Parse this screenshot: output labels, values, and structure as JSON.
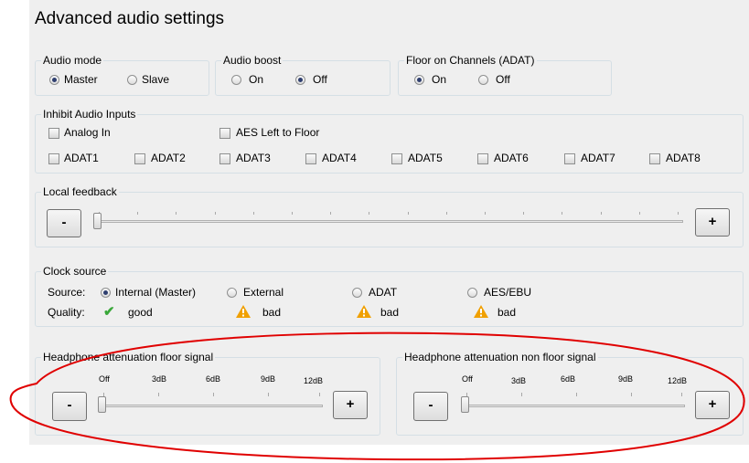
{
  "title": "Advanced audio settings",
  "audio_mode": {
    "label": "Audio mode",
    "options": [
      "Master",
      "Slave"
    ],
    "selected": "Master"
  },
  "audio_boost": {
    "label": "Audio boost",
    "options": [
      "On",
      "Off"
    ],
    "selected": "Off"
  },
  "floor_channels": {
    "label": "Floor on Channels (ADAT)",
    "options": [
      "On",
      "Off"
    ],
    "selected": "On"
  },
  "inhibit": {
    "label": "Inhibit Audio Inputs",
    "analog": "Analog In",
    "aes": "AES Left to Floor",
    "adat": [
      "ADAT1",
      "ADAT2",
      "ADAT3",
      "ADAT4",
      "ADAT5",
      "ADAT6",
      "ADAT7",
      "ADAT8"
    ]
  },
  "local_feedback": {
    "label": "Local feedback",
    "minus": "-",
    "plus": "+",
    "value_fraction": 0
  },
  "clock": {
    "label": "Clock source",
    "source_label": "Source:",
    "quality_label": "Quality:",
    "sources": [
      "Internal (Master)",
      "External",
      "ADAT",
      "AES/EBU"
    ],
    "selected": "Internal (Master)",
    "quality": [
      "good",
      "bad",
      "bad",
      "bad"
    ],
    "quality_icons": [
      "check-icon",
      "warning-icon",
      "warning-icon",
      "warning-icon"
    ]
  },
  "hp_floor": {
    "label": "Headphone attenuation floor signal",
    "scale": [
      "Off",
      "3dB",
      "6dB",
      "9dB",
      "12dB"
    ],
    "minus": "-",
    "plus": "+",
    "value": "Off"
  },
  "hp_nonfloor": {
    "label": "Headphone attenuation non floor signal",
    "scale": [
      "Off",
      "3dB",
      "6dB",
      "9dB",
      "12dB"
    ],
    "minus": "-",
    "plus": "+",
    "value": "Off"
  },
  "colors": {
    "annotation": "#e00000",
    "check": "#3aa83a",
    "warning": "#f0a000"
  }
}
